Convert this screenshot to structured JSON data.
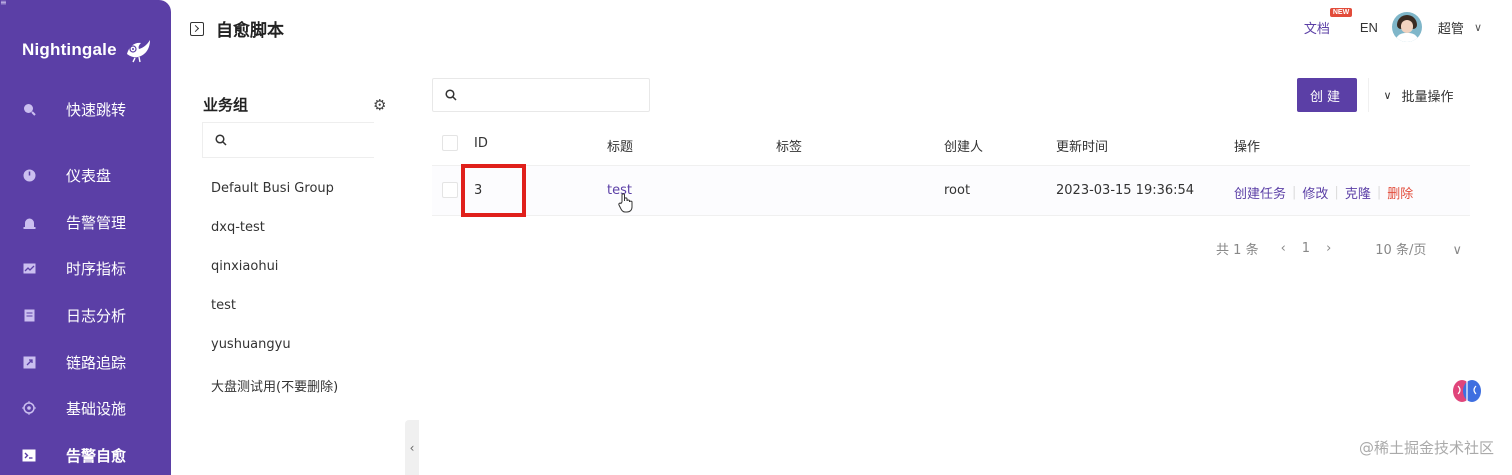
{
  "app": {
    "name": "Nightingale"
  },
  "sidebar": {
    "items": [
      {
        "label": "快速跳转",
        "icon": "search-icon"
      },
      {
        "label": "仪表盘",
        "icon": "dashboard-icon"
      },
      {
        "label": "告警管理",
        "icon": "alarm-icon"
      },
      {
        "label": "时序指标",
        "icon": "chart-icon"
      },
      {
        "label": "日志分析",
        "icon": "log-icon"
      },
      {
        "label": "链路追踪",
        "icon": "trace-icon"
      },
      {
        "label": "基础设施",
        "icon": "infra-icon"
      },
      {
        "label": "告警自愈",
        "icon": "terminal-icon",
        "active": true
      }
    ]
  },
  "header": {
    "title": "自愈脚本",
    "docs_label": "文档",
    "docs_badge": "NEW",
    "lang": "EN",
    "user": "超管"
  },
  "business_groups": {
    "title": "业务组",
    "search_placeholder": "",
    "items": [
      "Default Busi Group",
      "dxq-test",
      "qinxiaohui",
      "test",
      "yushuangyu",
      "大盘测试用(不要删除)"
    ]
  },
  "toolbar": {
    "search_placeholder": "",
    "create_label": "创建",
    "batch_label": "批量操作"
  },
  "table": {
    "columns": [
      "ID",
      "标题",
      "标签",
      "创建人",
      "更新时间",
      "操作"
    ],
    "rows": [
      {
        "id": "3",
        "title": "test",
        "tags": "",
        "creator": "root",
        "updated": "2023-03-15 19:36:54",
        "actions": [
          "创建任务",
          "修改",
          "克隆",
          "删除"
        ]
      }
    ]
  },
  "pagination": {
    "total": "共 1 条",
    "page": "1",
    "page_size": "10 条/页"
  },
  "watermark": "@稀土掘金技术社区",
  "colors": {
    "primary": "#5b3fa6",
    "danger": "#e24b3a",
    "highlight": "#e0201b"
  }
}
